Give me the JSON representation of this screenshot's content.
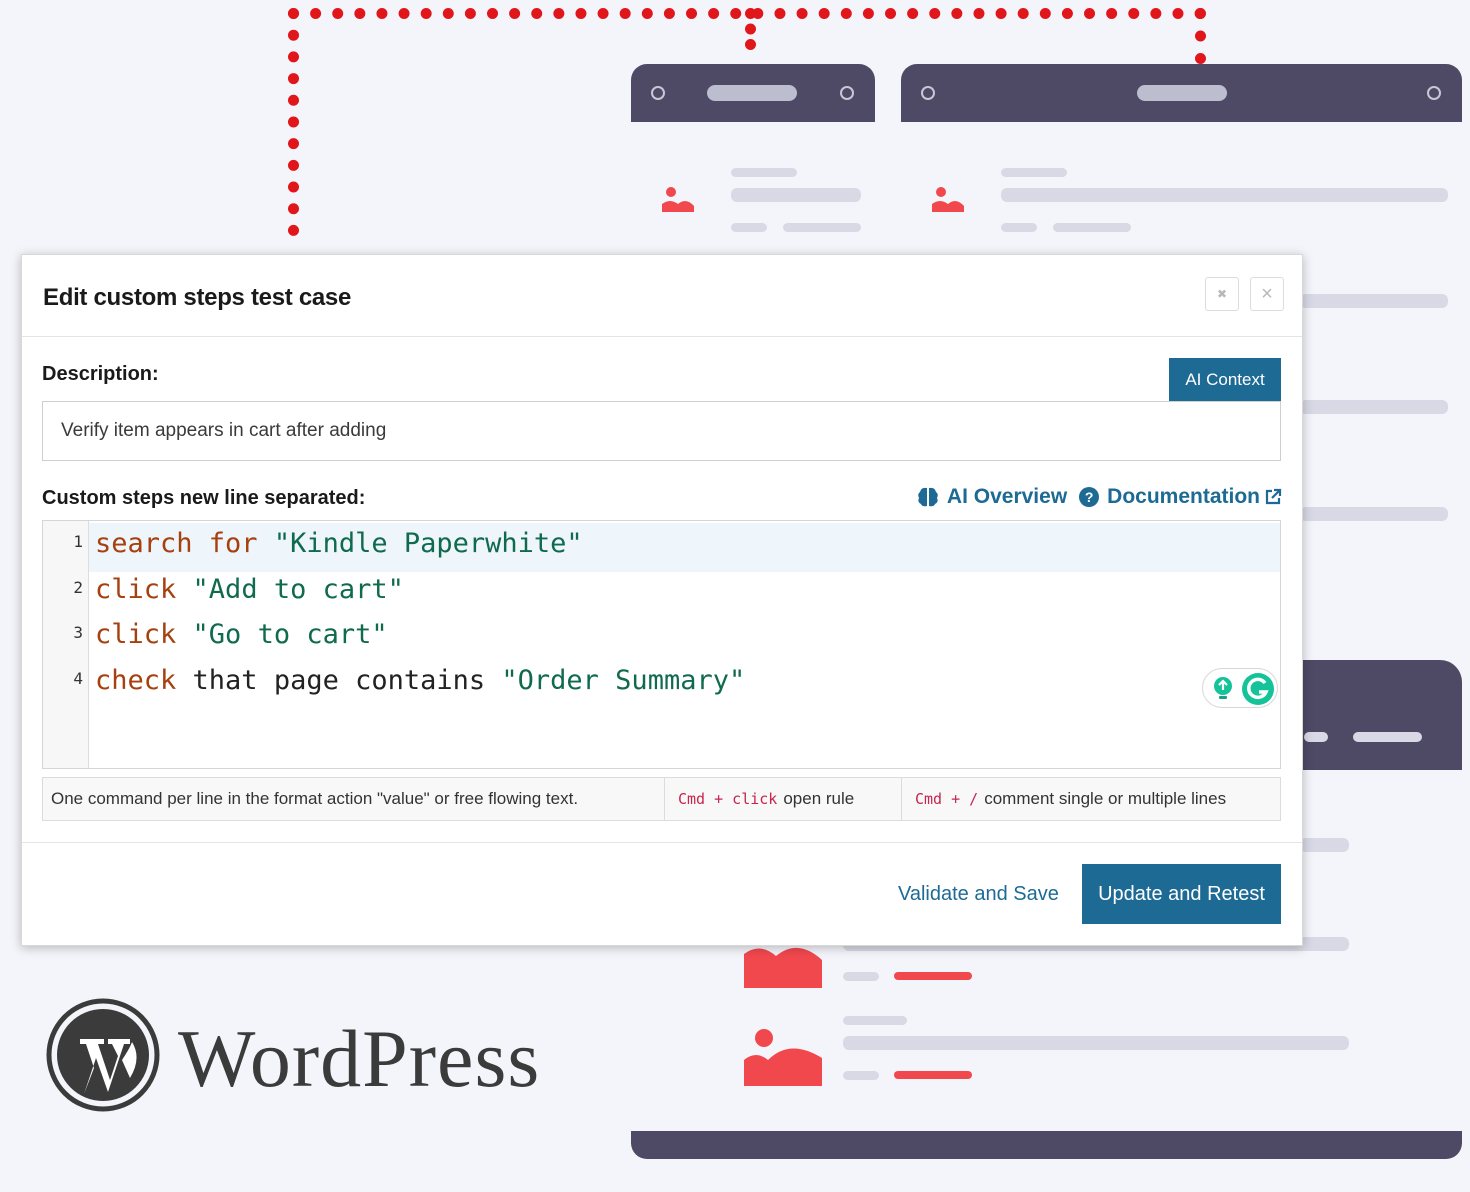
{
  "dialog": {
    "title": "Edit custom steps test case",
    "expand_icon": "✖",
    "close_icon": "×",
    "description_label": "Description:",
    "ai_context_label": "AI Context",
    "description_value": "Verify item appears in cart after adding",
    "steps_label": "Custom steps new line separated:",
    "ai_overview_label": "AI Overview",
    "documentation_label": "Documentation",
    "help_icon": "?",
    "lines": [
      {
        "num": "1",
        "parts": [
          {
            "t": "search for",
            "c": "kw"
          },
          {
            "t": " "
          },
          {
            "t": "\"Kindle Paperwhite\"",
            "c": "str"
          }
        ]
      },
      {
        "num": "2",
        "parts": [
          {
            "t": "click",
            "c": "kw"
          },
          {
            "t": " "
          },
          {
            "t": "\"Add to cart\"",
            "c": "str"
          }
        ]
      },
      {
        "num": "3",
        "parts": [
          {
            "t": "click",
            "c": "kw"
          },
          {
            "t": " "
          },
          {
            "t": "\"Go to cart\"",
            "c": "str"
          }
        ]
      },
      {
        "num": "4",
        "parts": [
          {
            "t": "check",
            "c": "kw"
          },
          {
            "t": " that page contains "
          },
          {
            "t": "\"Order Summary\"",
            "c": "str"
          }
        ]
      }
    ],
    "hints": {
      "format": "One command per line in the format action \"value\" or free flowing text.",
      "open_rule_kbd": "Cmd + click",
      "open_rule_text": "open rule",
      "comment_kbd": "Cmd + /",
      "comment_text": "comment single or multiple lines"
    },
    "validate_label": "Validate and Save",
    "update_label": "Update and Retest"
  },
  "logo": {
    "wordmark": "WordPress"
  },
  "colors": {
    "accent": "#1d6a94",
    "keyword": "#a6400f",
    "string": "#106a4e",
    "illustration_dark": "#4e4a66",
    "illustration_red": "#f1484e",
    "dashed_line": "#e0161b"
  }
}
